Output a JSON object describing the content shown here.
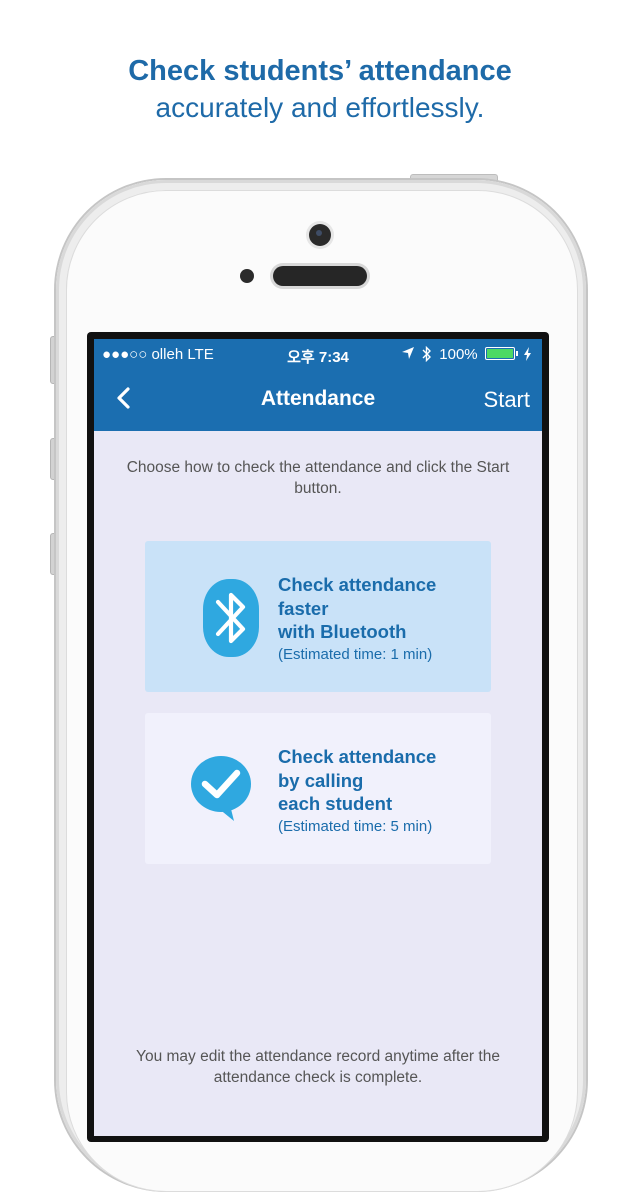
{
  "headline": {
    "line1": "Check students’ attendance",
    "line2": "accurately and effortlessly."
  },
  "status_bar": {
    "left": "●●●○○ olleh  LTE",
    "time": "오후 7:34",
    "battery": "100%"
  },
  "nav": {
    "title": "Attendance",
    "start_label": "Start",
    "back_icon": "chevron-left-icon"
  },
  "instructions": "Choose how to check the attendance and click the Start button.",
  "options": [
    {
      "icon": "bluetooth-icon",
      "title_lines": [
        "Check attendance",
        "faster",
        "with Bluetooth"
      ],
      "time": "(Estimated time: 1 min)",
      "selected": true
    },
    {
      "icon": "checkmark-bubble-icon",
      "title_lines": [
        "Check attendance",
        "by calling",
        "each student"
      ],
      "time": "(Estimated time: 5 min)",
      "selected": false
    }
  ],
  "footer": "You may edit the attendance record anytime after the attendance check is complete.",
  "colors": {
    "brand_blue": "#1b6eb0",
    "icon_blue": "#2fa8e0",
    "selected_card": "#c9e2f8",
    "screen_bg": "#e9e8f6"
  }
}
